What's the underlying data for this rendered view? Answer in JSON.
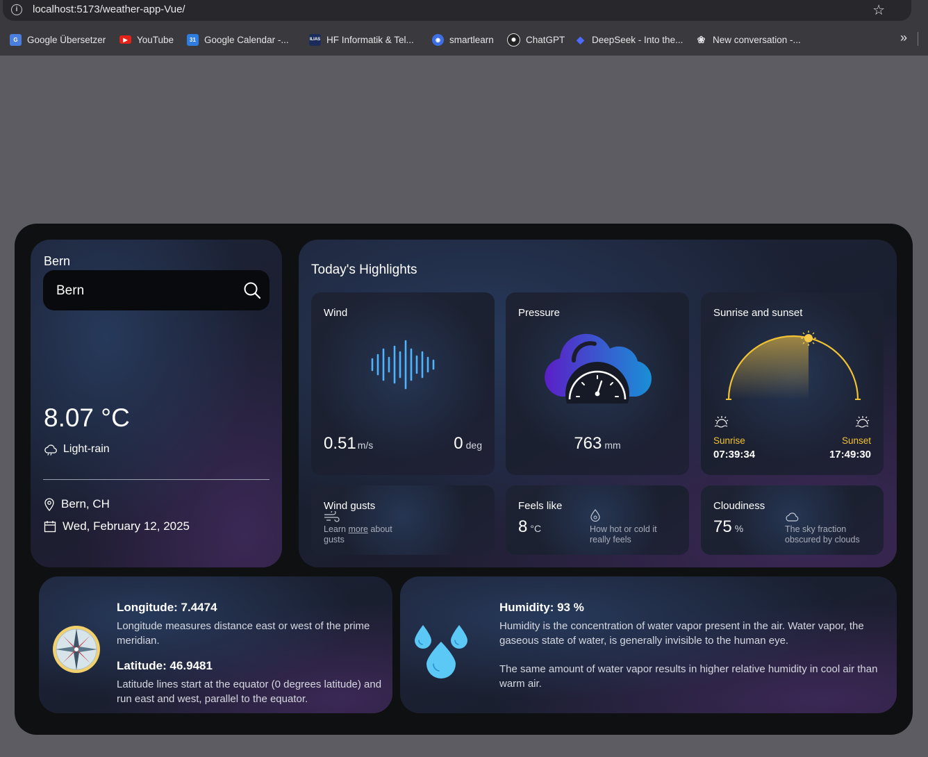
{
  "browser": {
    "url": "localhost:5173/weather-app-Vue/",
    "bookmarks": [
      {
        "label": "Google Übersetzer"
      },
      {
        "label": "YouTube"
      },
      {
        "label": "Google Calendar -..."
      },
      {
        "label": "HF Informatik & Tel..."
      },
      {
        "label": "smartlearn"
      },
      {
        "label": "ChatGPT"
      },
      {
        "label": "DeepSeek - Into the..."
      },
      {
        "label": "New conversation -..."
      }
    ]
  },
  "left": {
    "city_label": "Bern",
    "search_value": "Bern",
    "temperature": "8.07 °C",
    "condition": "Light-rain",
    "location": "Bern, CH",
    "date": "Wed, February 12, 2025"
  },
  "highlights": {
    "title": "Today's Highlights",
    "wind": {
      "title": "Wind",
      "speed": "0.51",
      "speed_unit": "m/s",
      "deg": "0",
      "deg_unit": "deg"
    },
    "pressure": {
      "title": "Pressure",
      "value": "763",
      "unit": "mm"
    },
    "sun": {
      "title": "Sunrise and sunset",
      "sunrise_label": "Sunrise",
      "sunrise": "07:39:34",
      "sunset_label": "Sunset",
      "sunset": "17:49:30"
    },
    "gusts": {
      "title": "Wind gusts",
      "note_pre": "Learn ",
      "note_link": "more",
      "note_post": " about",
      "note_line2": "gusts"
    },
    "feels": {
      "title": "Feels like",
      "value": "8",
      "unit": "°C",
      "note1": "How hot or cold it",
      "note2": "really feels"
    },
    "cloud": {
      "title": "Cloudiness",
      "value": "75",
      "unit": "%",
      "note1": "The sky fraction",
      "note2": "obscured by clouds"
    }
  },
  "geo": {
    "longitude_title": "Longitude: 7.4474",
    "longitude_text": "Longitude measures distance east or west of the prime meridian.",
    "latitude_title": "Latitude: 46.9481",
    "latitude_text": "Latitude lines start at the equator (0 degrees latitude) and run east and west, parallel to the equator."
  },
  "humidity": {
    "title": "Humidity: 93 %",
    "text1": "Humidity is the concentration of water vapor present in the air. Water vapor, the gaseous state of water, is generally invisible to the human eye.",
    "text2": "The same amount of water vapor results in higher relative humidity in cool air than warm air."
  },
  "colors": {
    "accent_sun": "#f1c232",
    "drop": "#5cc8f5"
  }
}
